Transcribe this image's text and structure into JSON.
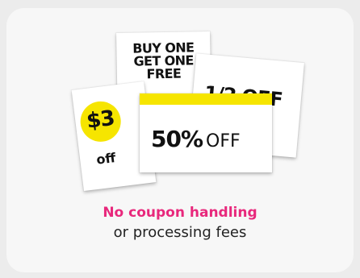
{
  "coupons": {
    "bogo": [
      "BUY ONE",
      "GET ONE",
      "FREE"
    ],
    "half": "1/2 OFF",
    "dollar": {
      "amount": "$3",
      "label": "off"
    },
    "percent": {
      "value": "50%",
      "label": "OFF"
    }
  },
  "title": "No coupon handling",
  "subtitle": "or processing fees",
  "colors": {
    "accent": "#e8287c",
    "highlight": "#f6e500",
    "card_bg": "#f7f7f7"
  }
}
